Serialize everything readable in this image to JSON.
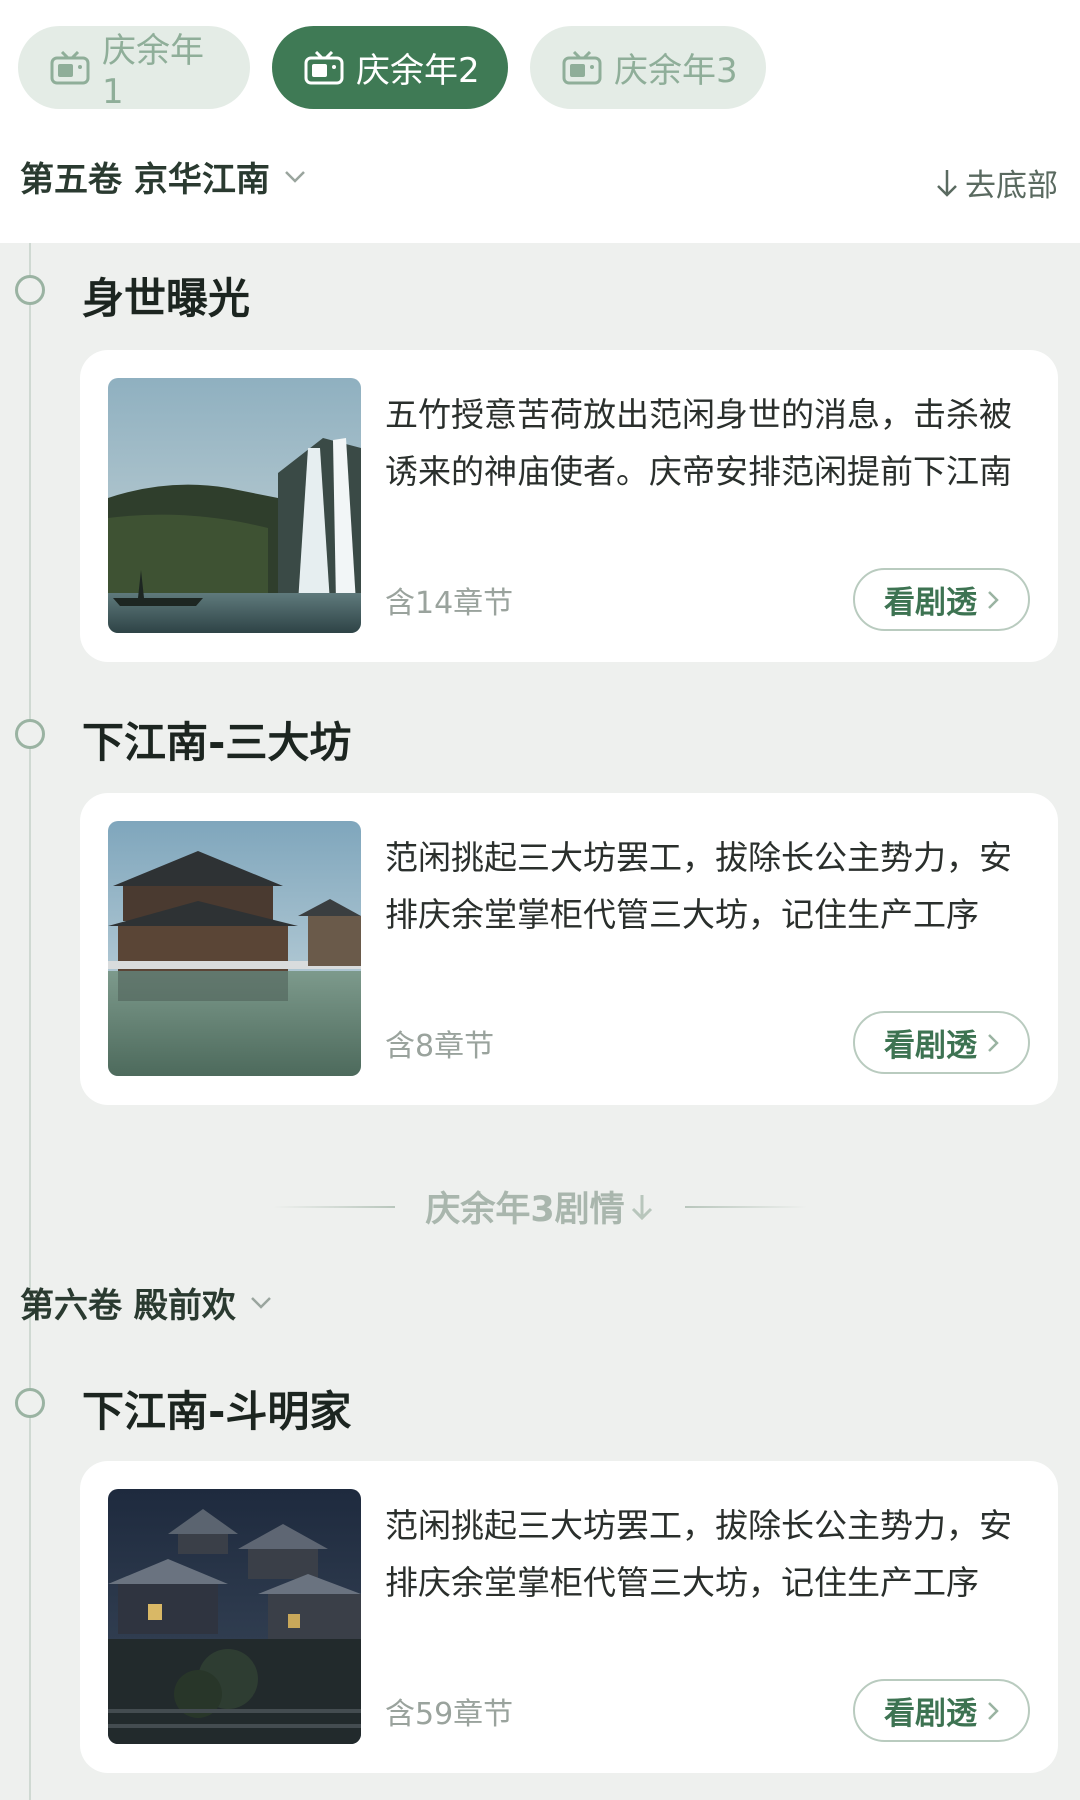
{
  "tabs": [
    {
      "label": "庆余年1",
      "active": false
    },
    {
      "label": "庆余年2",
      "active": true
    },
    {
      "label": "庆余年3",
      "active": false
    }
  ],
  "volume1": {
    "title": "第五卷 京华江南"
  },
  "to_bottom_label": "去底部",
  "sections": [
    {
      "title": "身世曝光",
      "description": "五竹授意苦荷放出范闲身世的消息，击杀被诱来的神庙使者。庆帝安排范闲提前下江南",
      "chapters": "含14章节",
      "button": "看剧透"
    },
    {
      "title": "下江南-三大坊",
      "description": "范闲挑起三大坊罢工，拔除长公主势力，安排庆余堂掌柜代管三大坊，记住生产工序",
      "chapters": "含8章节",
      "button": "看剧透"
    },
    {
      "title": "下江南-斗明家",
      "description": "范闲挑起三大坊罢工，拔除长公主势力，安排庆余堂掌柜代管三大坊，记住生产工序",
      "chapters": "含59章节",
      "button": "看剧透"
    }
  ],
  "divider_label": "庆余年3剧情",
  "volume2": {
    "title": "第六卷 殿前欢"
  },
  "colors": {
    "accent": "#3f7a55",
    "tab_inactive_bg": "#e4ece6",
    "page_bg": "#eef0ee"
  }
}
